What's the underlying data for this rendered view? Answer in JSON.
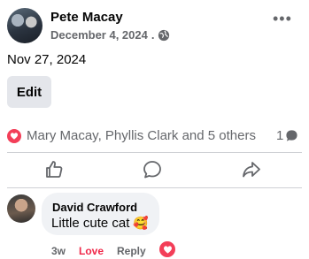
{
  "post": {
    "author": "Pete Macay",
    "date": "December 4, 2024",
    "separator": ".",
    "privacy_icon": "globe-icon",
    "text": "Nov 27, 2024",
    "edit_label": "Edit",
    "menu_glyph": "•••"
  },
  "reactions": {
    "summary": "Mary Macay, Phyllis Clark and 5 others",
    "comment_count": "1",
    "reaction_icon": "love-heart-icon",
    "accent": "#f33e58"
  },
  "actions": {
    "like_icon": "thumbs-up-icon",
    "comment_icon": "comment-icon",
    "share_icon": "share-icon"
  },
  "comment": {
    "author": "David Crawford",
    "text": "Little cute cat",
    "emoji": "🥰",
    "time": "3w",
    "reaction_label": "Love",
    "reply_label": "Reply",
    "love_color": "#f02849"
  }
}
